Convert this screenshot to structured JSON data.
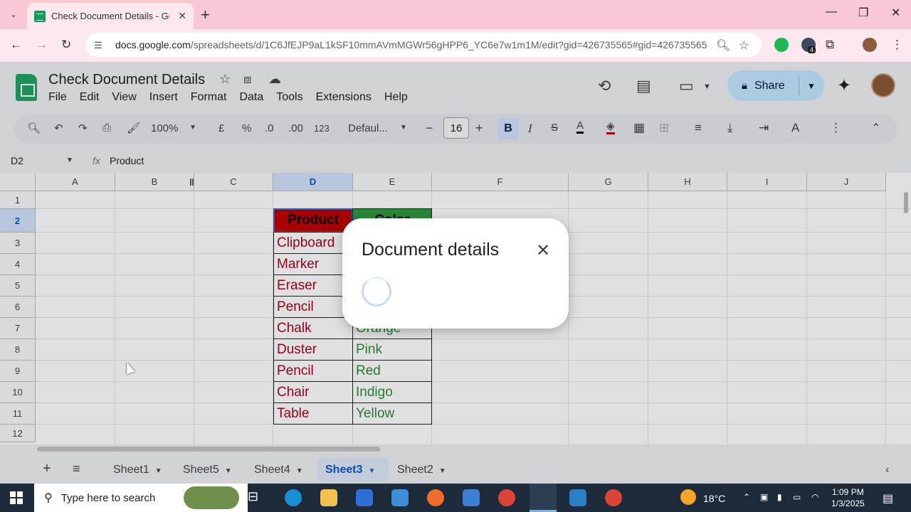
{
  "browser": {
    "tab_title": "Check Document Details - Goo",
    "url_host": "docs.google.com",
    "url_path": "/spreadsheets/d/1C6JfEJP9aL1kSF10mmAVmMGWr56gHPP6_YC6e7w1m1M/edit?gid=426735565#gid=426735565",
    "extension_badge": "4"
  },
  "doc": {
    "title": "Check Document Details",
    "menu": [
      "File",
      "Edit",
      "View",
      "Insert",
      "Format",
      "Data",
      "Tools",
      "Extensions",
      "Help"
    ],
    "share_label": "Share"
  },
  "toolbar": {
    "zoom": "100%",
    "currency": "£",
    "percent": "%",
    "dec_decrease": ".0",
    "dec_increase": ".00",
    "number_format": "123",
    "font": "Defaul...",
    "font_size": "16",
    "bold": "B",
    "italic": "I"
  },
  "formula_bar": {
    "name_box": "D2",
    "fx": "fx",
    "value": "Product"
  },
  "grid": {
    "columns": [
      "A",
      "B",
      "C",
      "D",
      "E",
      "F",
      "G",
      "H",
      "I",
      "J"
    ],
    "rows": [
      "1",
      "2",
      "3",
      "4",
      "5",
      "6",
      "7",
      "8",
      "9",
      "10",
      "11",
      "12"
    ],
    "header_product": "Product",
    "header_color": "Color",
    "products": [
      "Clipboard",
      "Marker",
      "Eraser",
      "Pencil",
      "Chalk",
      "Duster",
      "Pencil",
      "Chair",
      "Table"
    ],
    "colors": [
      "",
      "",
      "",
      "",
      "Orange",
      "Pink",
      "Red",
      "Indigo",
      "Yellow"
    ]
  },
  "sheets": [
    "Sheet1",
    "Sheet5",
    "Sheet4",
    "Sheet3",
    "Sheet2"
  ],
  "active_sheet": "Sheet3",
  "dialog": {
    "title": "Document details",
    "close": "✕"
  },
  "taskbar": {
    "search_placeholder": "Type here to search",
    "temperature": "18°C",
    "time": "1:09 PM",
    "date": "1/3/2025"
  },
  "colors": {
    "accent": "#0b57d0",
    "product_text": "#b00020",
    "color_text": "#2e8b3e",
    "tab_bar": "#f8c9d4"
  }
}
